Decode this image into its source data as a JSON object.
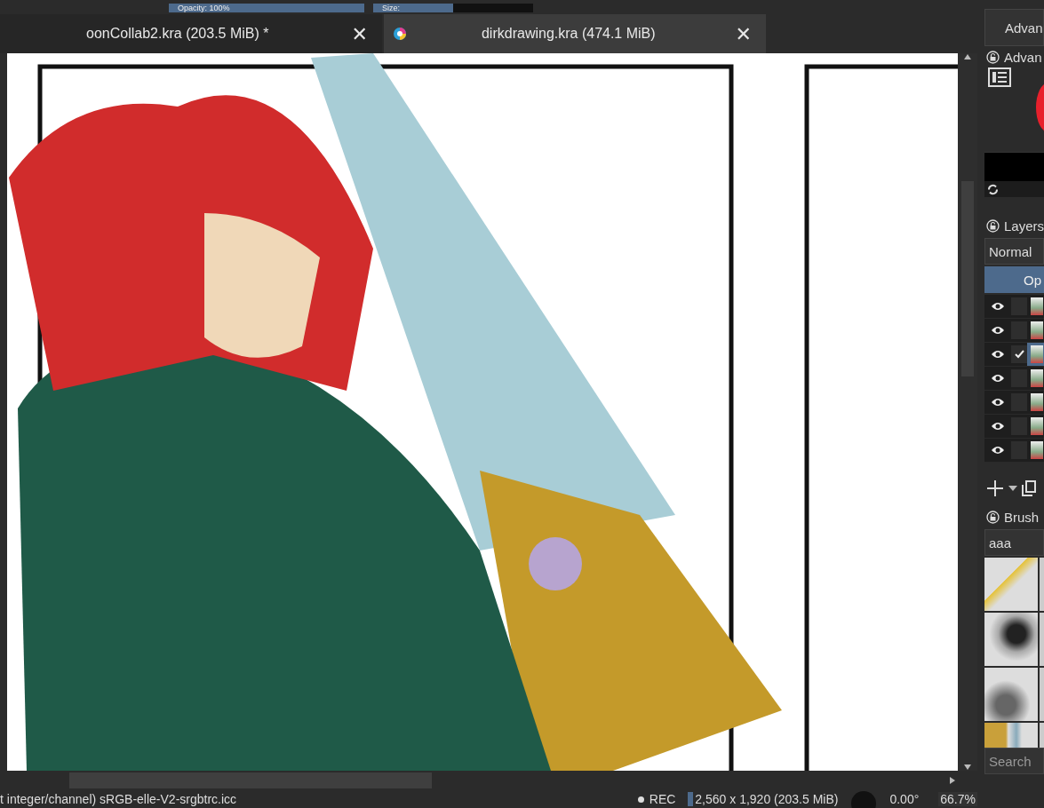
{
  "toolbar": {
    "opacity": {
      "label": "Opacity: 100%",
      "level": 1
    },
    "size": {
      "label": "Size:",
      "level": 0.5
    }
  },
  "tabs": [
    {
      "label": "oonCollab2.kra (203.5 MiB) *",
      "selected": false,
      "close": "✕"
    },
    {
      "label": "dirkdrawing.kra (474.1 MiB)",
      "selected": true,
      "close": "✕"
    }
  ],
  "dock": {
    "tab": "Advan",
    "color_panel": {
      "title": "Advan"
    },
    "layers": {
      "title": "Layers",
      "blend_mode": "Normal",
      "opacity_button": "Op",
      "rows": [
        {
          "selected": false,
          "checked": false
        },
        {
          "selected": false,
          "checked": false
        },
        {
          "selected": true,
          "checked": true
        },
        {
          "selected": false,
          "checked": false
        },
        {
          "selected": false,
          "checked": false
        },
        {
          "selected": false,
          "checked": false
        },
        {
          "selected": false,
          "checked": false
        }
      ]
    },
    "brushes": {
      "title": "Brush",
      "tag": "aaa",
      "search_placeholder": "Search"
    }
  },
  "status_bar": {
    "color_info": "t integer/channel)  sRGB-elle-V2-srgbtrc.icc",
    "rec": "REC",
    "dimensions": "2,560 x 1,920 (203.5 MiB)",
    "rotation": "0.00°",
    "zoom": "66.7%"
  }
}
